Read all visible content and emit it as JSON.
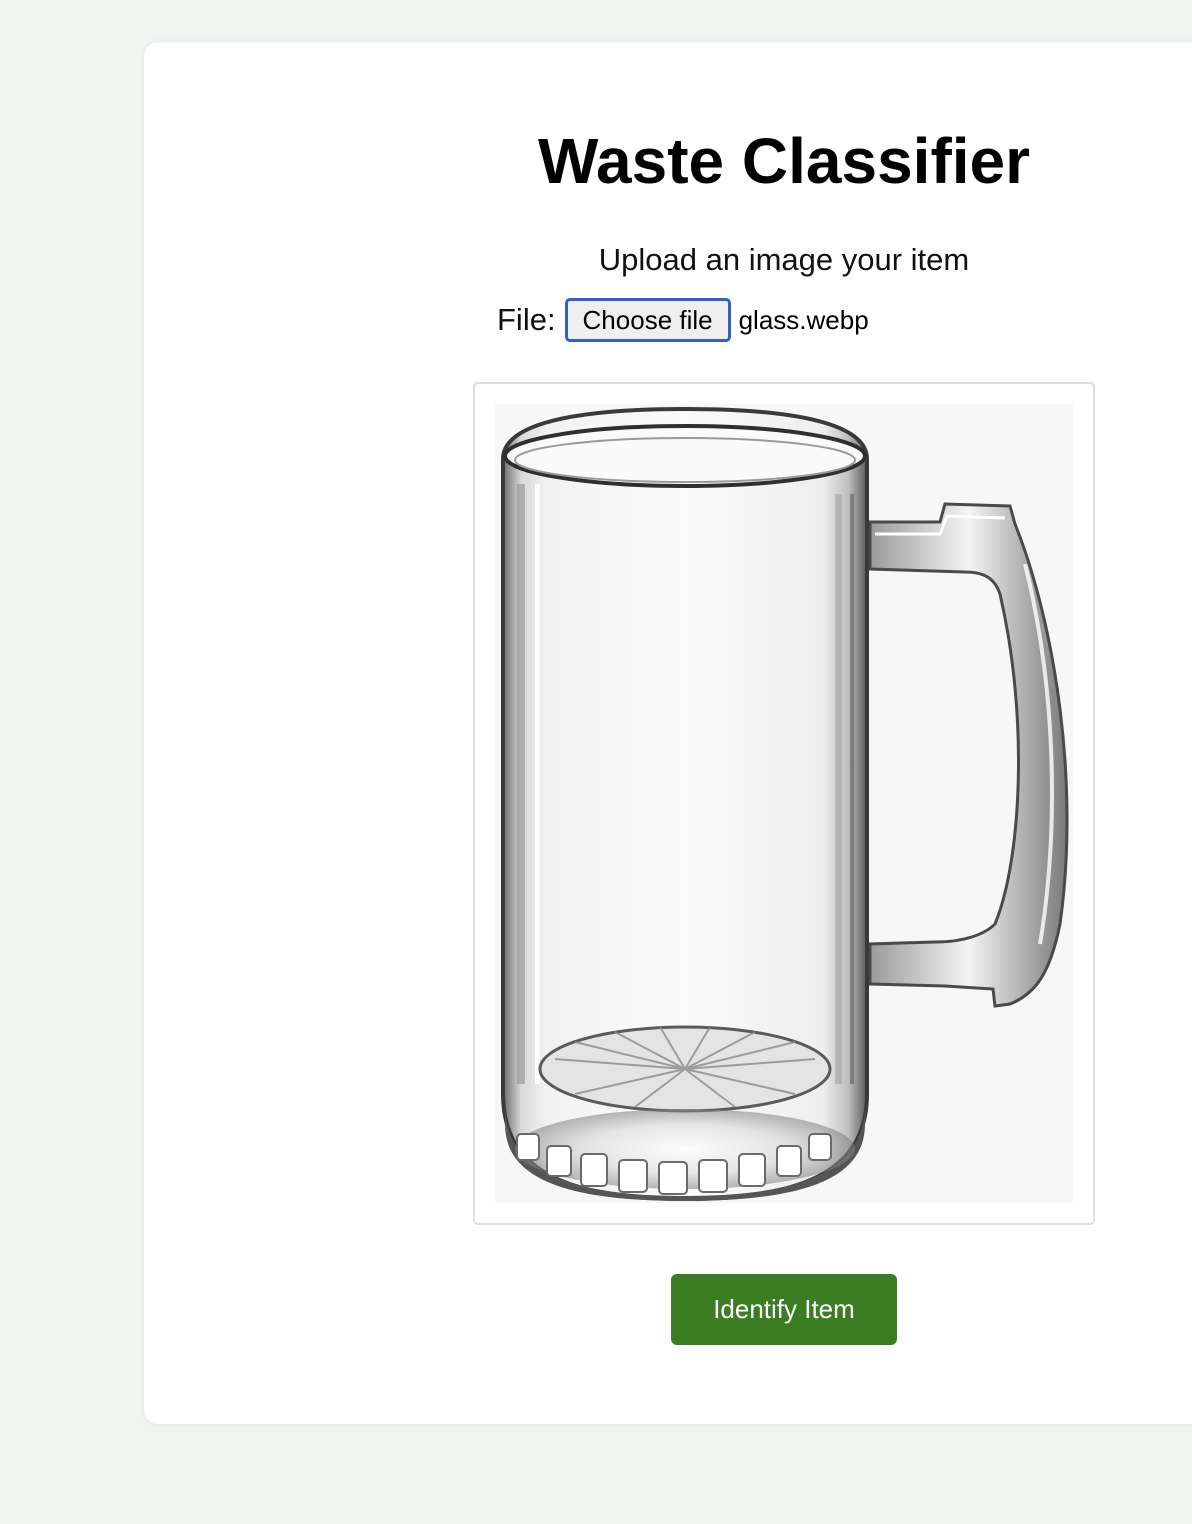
{
  "header": {
    "title": "Waste Classifier",
    "subtitle": "Upload an image your item"
  },
  "upload": {
    "label": "File:",
    "button_label": "Choose file",
    "file_name": "glass.webp"
  },
  "preview": {
    "image_subject": "glass beer mug"
  },
  "actions": {
    "identify_label": "Identify Item",
    "identify_color": "#3a7d22"
  },
  "colors": {
    "page_background": "#f1f5f1",
    "card_background": "#ffffff",
    "file_button_border": "#2f62c3"
  }
}
